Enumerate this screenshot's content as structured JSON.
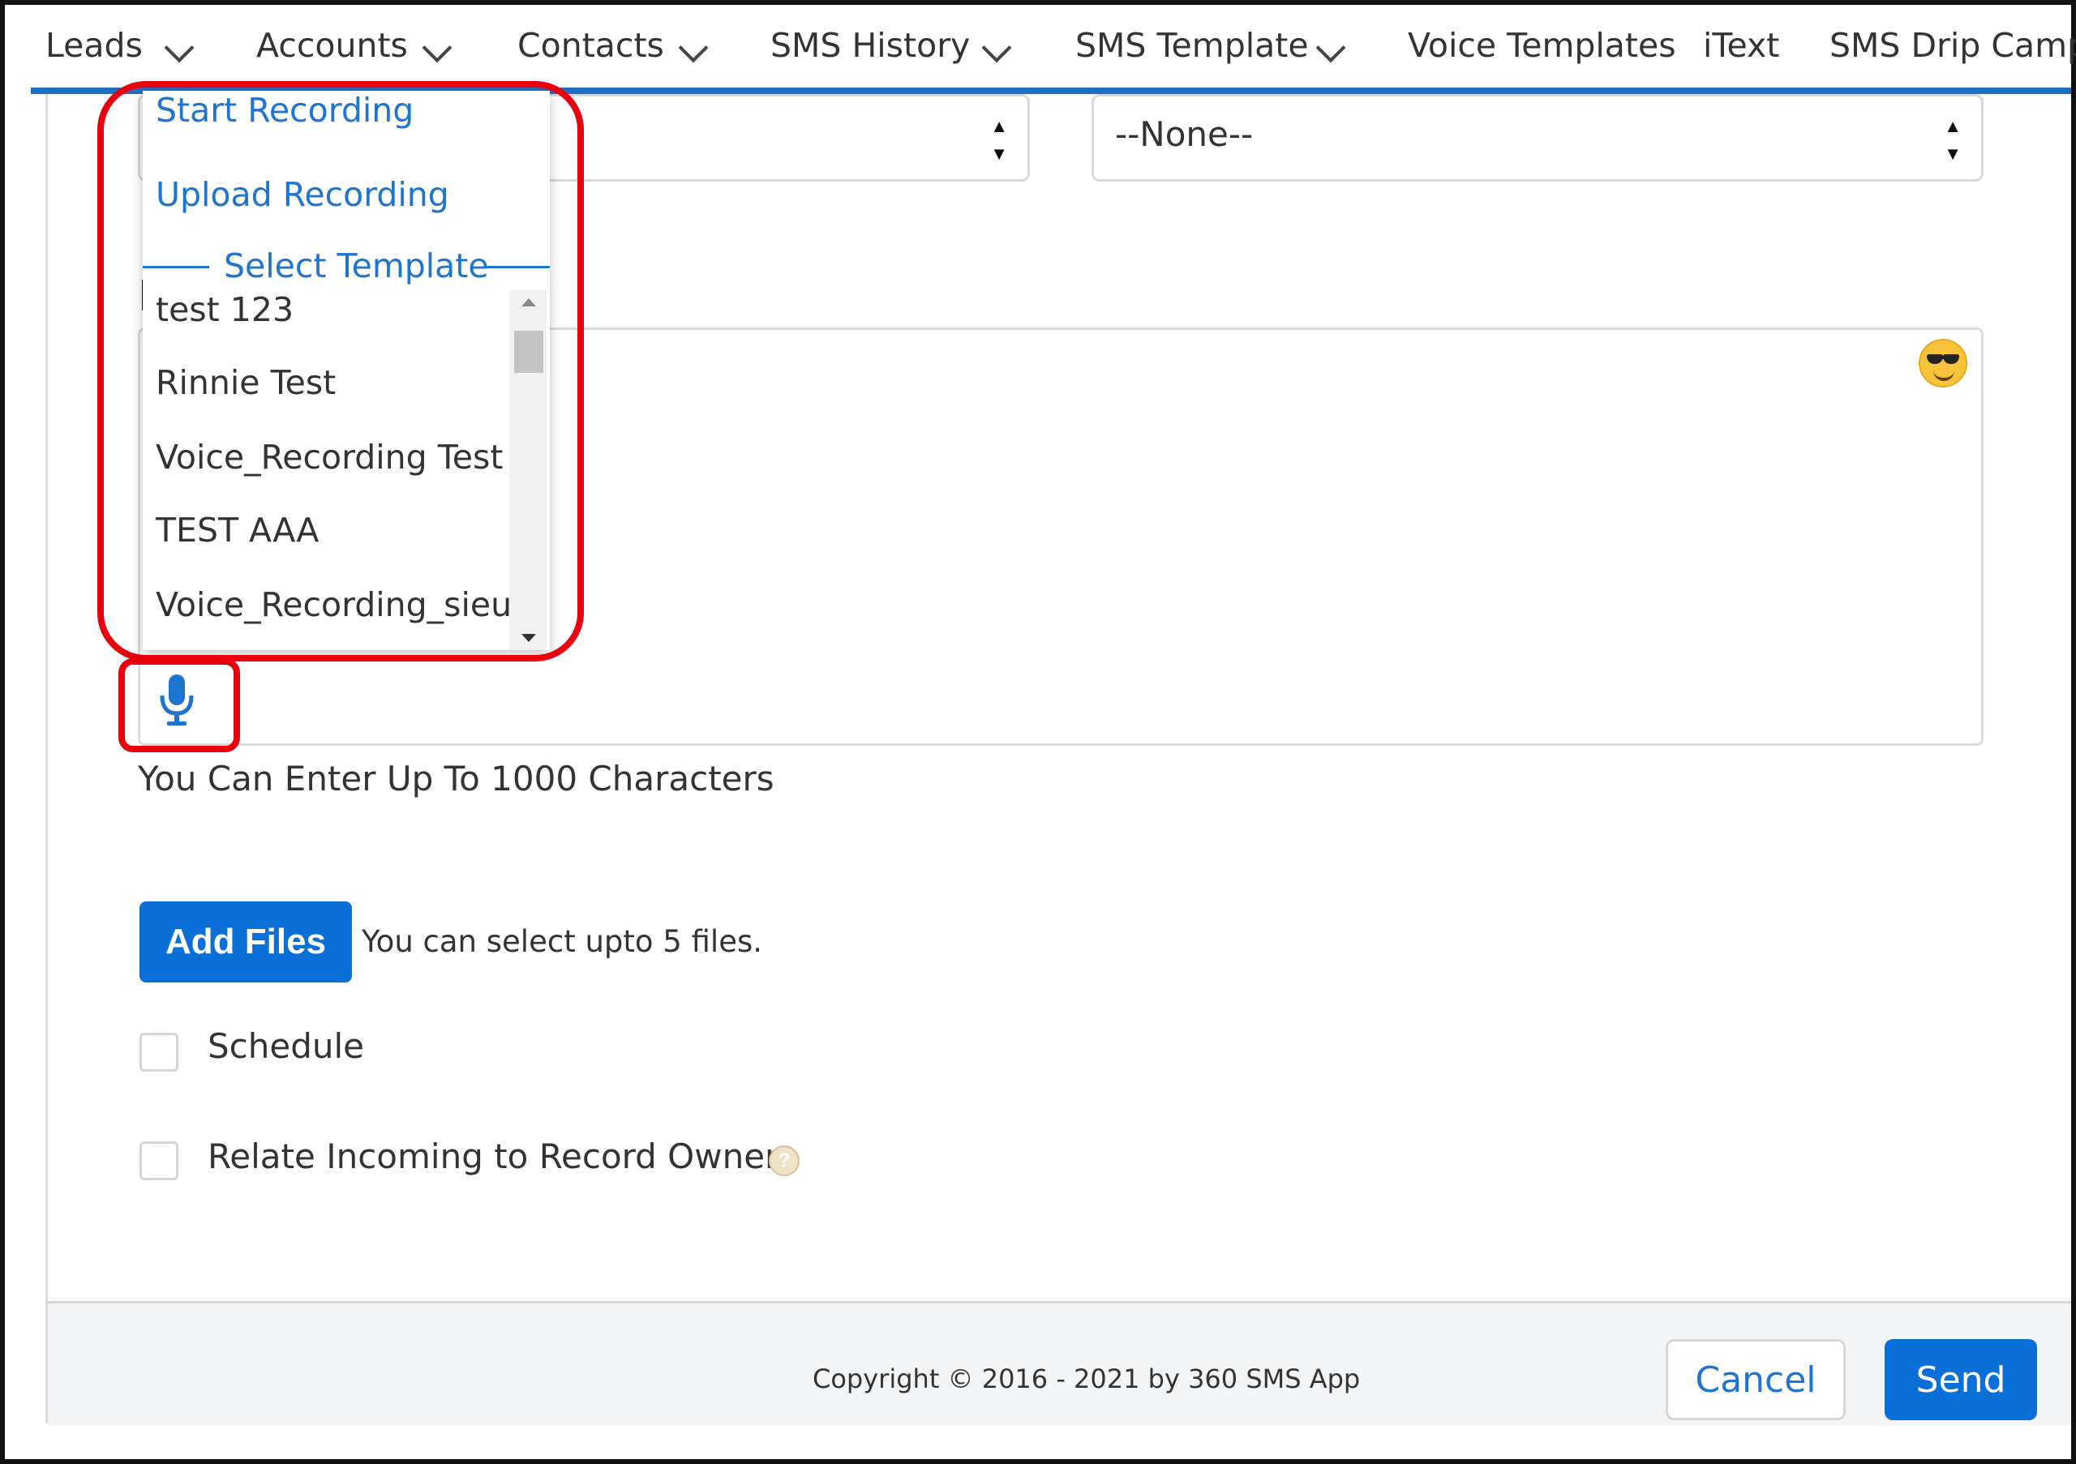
{
  "nav": {
    "items": [
      {
        "label": "Leads",
        "has_menu": true
      },
      {
        "label": "Accounts",
        "has_menu": true
      },
      {
        "label": "Contacts",
        "has_menu": true
      },
      {
        "label": "SMS History",
        "has_menu": true
      },
      {
        "label": "SMS Template",
        "has_menu": true
      },
      {
        "label": "Voice Templates",
        "has_menu": false
      },
      {
        "label": "iText",
        "has_menu": false
      },
      {
        "label": "SMS Drip Campa",
        "has_menu": false
      }
    ]
  },
  "selects": {
    "template_select_value": "",
    "right_select_value": "--None--"
  },
  "dropdown": {
    "actions": [
      "Start Recording",
      "Upload Recording"
    ],
    "heading": "Select Template",
    "options": [
      "test 123",
      "Rinnie Test",
      "Voice_Recording Test",
      "TEST AAA",
      "Voice_Recording_sieu"
    ]
  },
  "message": {
    "hint": "You Can Enter Up To 1000 Characters",
    "emoji_icon": "sunglasses-emoji-icon",
    "mic_icon": "microphone-icon"
  },
  "files": {
    "button_label": "Add Files",
    "note": "You can select upto 5 files."
  },
  "options": {
    "schedule_label": "Schedule",
    "schedule_checked": false,
    "relate_label": "Relate Incoming to Record Owner",
    "relate_checked": false,
    "help_icon": "question-icon"
  },
  "footer": {
    "copyright": "Copyright © 2016 - 2021 by 360 SMS App",
    "cancel_label": "Cancel",
    "send_label": "Send"
  },
  "colors": {
    "accent": "#0b6fd8",
    "link": "#1f74d0",
    "highlight": "#e8000e"
  }
}
